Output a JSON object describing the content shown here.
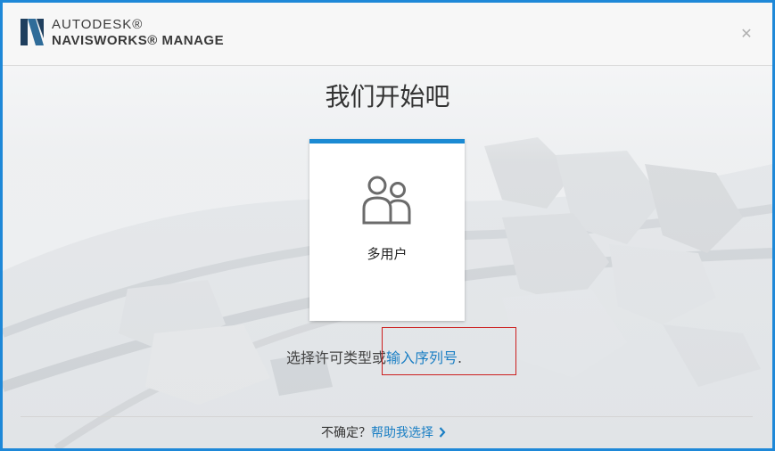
{
  "header": {
    "brand_line1": "AUTODESK®",
    "brand_line2": "NAVISWORKS® MANAGE",
    "close_icon": "close-icon"
  },
  "main": {
    "title": "我们开始吧",
    "cards": [
      {
        "label": "多用户",
        "icon": "users-icon",
        "accent": "#1b8ad3"
      }
    ],
    "license_prefix": "选择许可类型或",
    "serial_link": "输入序列号",
    "license_suffix": "."
  },
  "footer": {
    "unsure_text": "不确定？",
    "help_link": "帮助我选择",
    "help_icon": "chevron-right-icon"
  },
  "colors": {
    "accent": "#1b8ad3",
    "link": "#1b7fc4",
    "highlight": "#cc1f1f",
    "frame": "#1e88d8"
  }
}
